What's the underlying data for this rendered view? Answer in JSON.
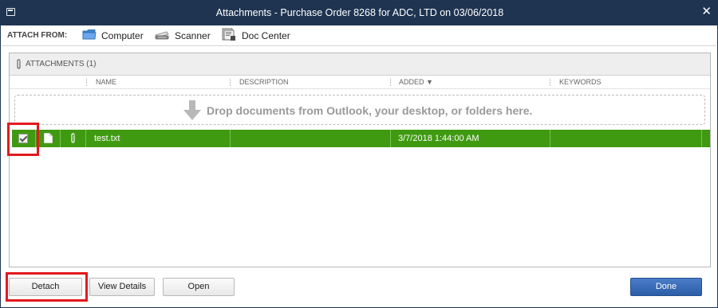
{
  "window": {
    "title": "Attachments - Purchase Order 8268 for ADC, LTD on 03/06/2018"
  },
  "attach_from": {
    "label": "ATTACH FROM:",
    "sources": [
      {
        "label": "Computer",
        "icon": "folder-icon"
      },
      {
        "label": "Scanner",
        "icon": "scanner-icon"
      },
      {
        "label": "Doc Center",
        "icon": "doc-center-icon"
      }
    ]
  },
  "attachments": {
    "header": "ATTACHMENTS (1)",
    "columns": [
      "NAME",
      "DESCRIPTION",
      "ADDED ▼",
      "KEYWORDS"
    ],
    "drop_text": "Drop documents from Outlook, your desktop, or folders here.",
    "rows": [
      {
        "checked": true,
        "name": "test.txt",
        "description": "",
        "added": "3/7/2018 1:44:00 AM",
        "keywords": ""
      }
    ]
  },
  "buttons": {
    "detach": "Detach",
    "view_details": "View Details",
    "open": "Open",
    "done": "Done"
  },
  "colors": {
    "titlebar": "#1e3451",
    "selected_row": "#3f9a11",
    "highlight": "#e2191e",
    "primary_button": "#2c5ea8"
  }
}
